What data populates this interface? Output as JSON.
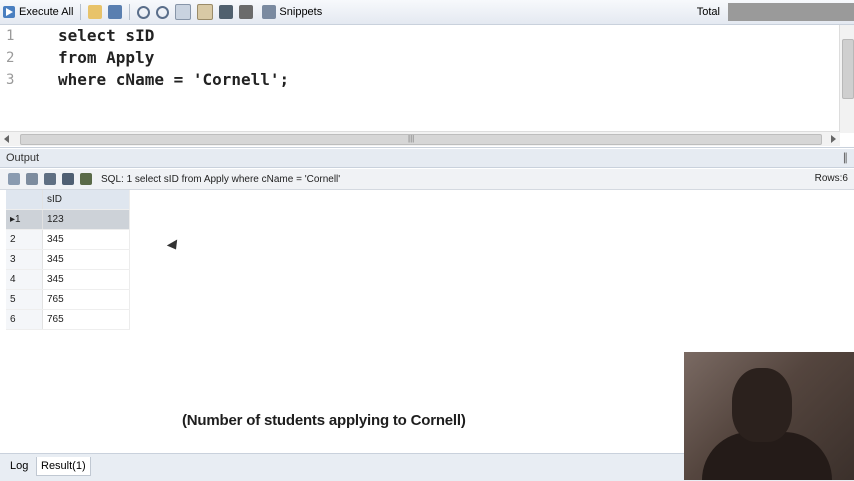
{
  "toolbar": {
    "execute_label": "Execute All",
    "snippets_label": "Snippets",
    "total_label": "Total"
  },
  "editor": {
    "lines": [
      {
        "num": "1",
        "code": "select sID"
      },
      {
        "num": "2",
        "code": "from Apply"
      },
      {
        "num": "3",
        "code": "where cName = 'Cornell';"
      }
    ]
  },
  "output": {
    "title": "Output",
    "sql_text": "SQL: 1 select sID  from Apply  where cName = 'Cornell'",
    "rows_label": "Rows:6",
    "column": "sID",
    "rows": [
      {
        "n": "1",
        "v": "123"
      },
      {
        "n": "2",
        "v": "345"
      },
      {
        "n": "3",
        "v": "345"
      },
      {
        "n": "4",
        "v": "345"
      },
      {
        "n": "5",
        "v": "765"
      },
      {
        "n": "6",
        "v": "765"
      }
    ]
  },
  "caption": "(Number of students applying to Cornell)",
  "tabs": {
    "log": "Log",
    "result": "Result(1)"
  },
  "icons": [
    "execute-icon",
    "open-icon",
    "save-icon",
    "undo-icon",
    "redo-icon",
    "copy-icon",
    "paste-icon",
    "brush-icon",
    "tools-icon",
    "snippets-icon",
    "pin-icon"
  ]
}
